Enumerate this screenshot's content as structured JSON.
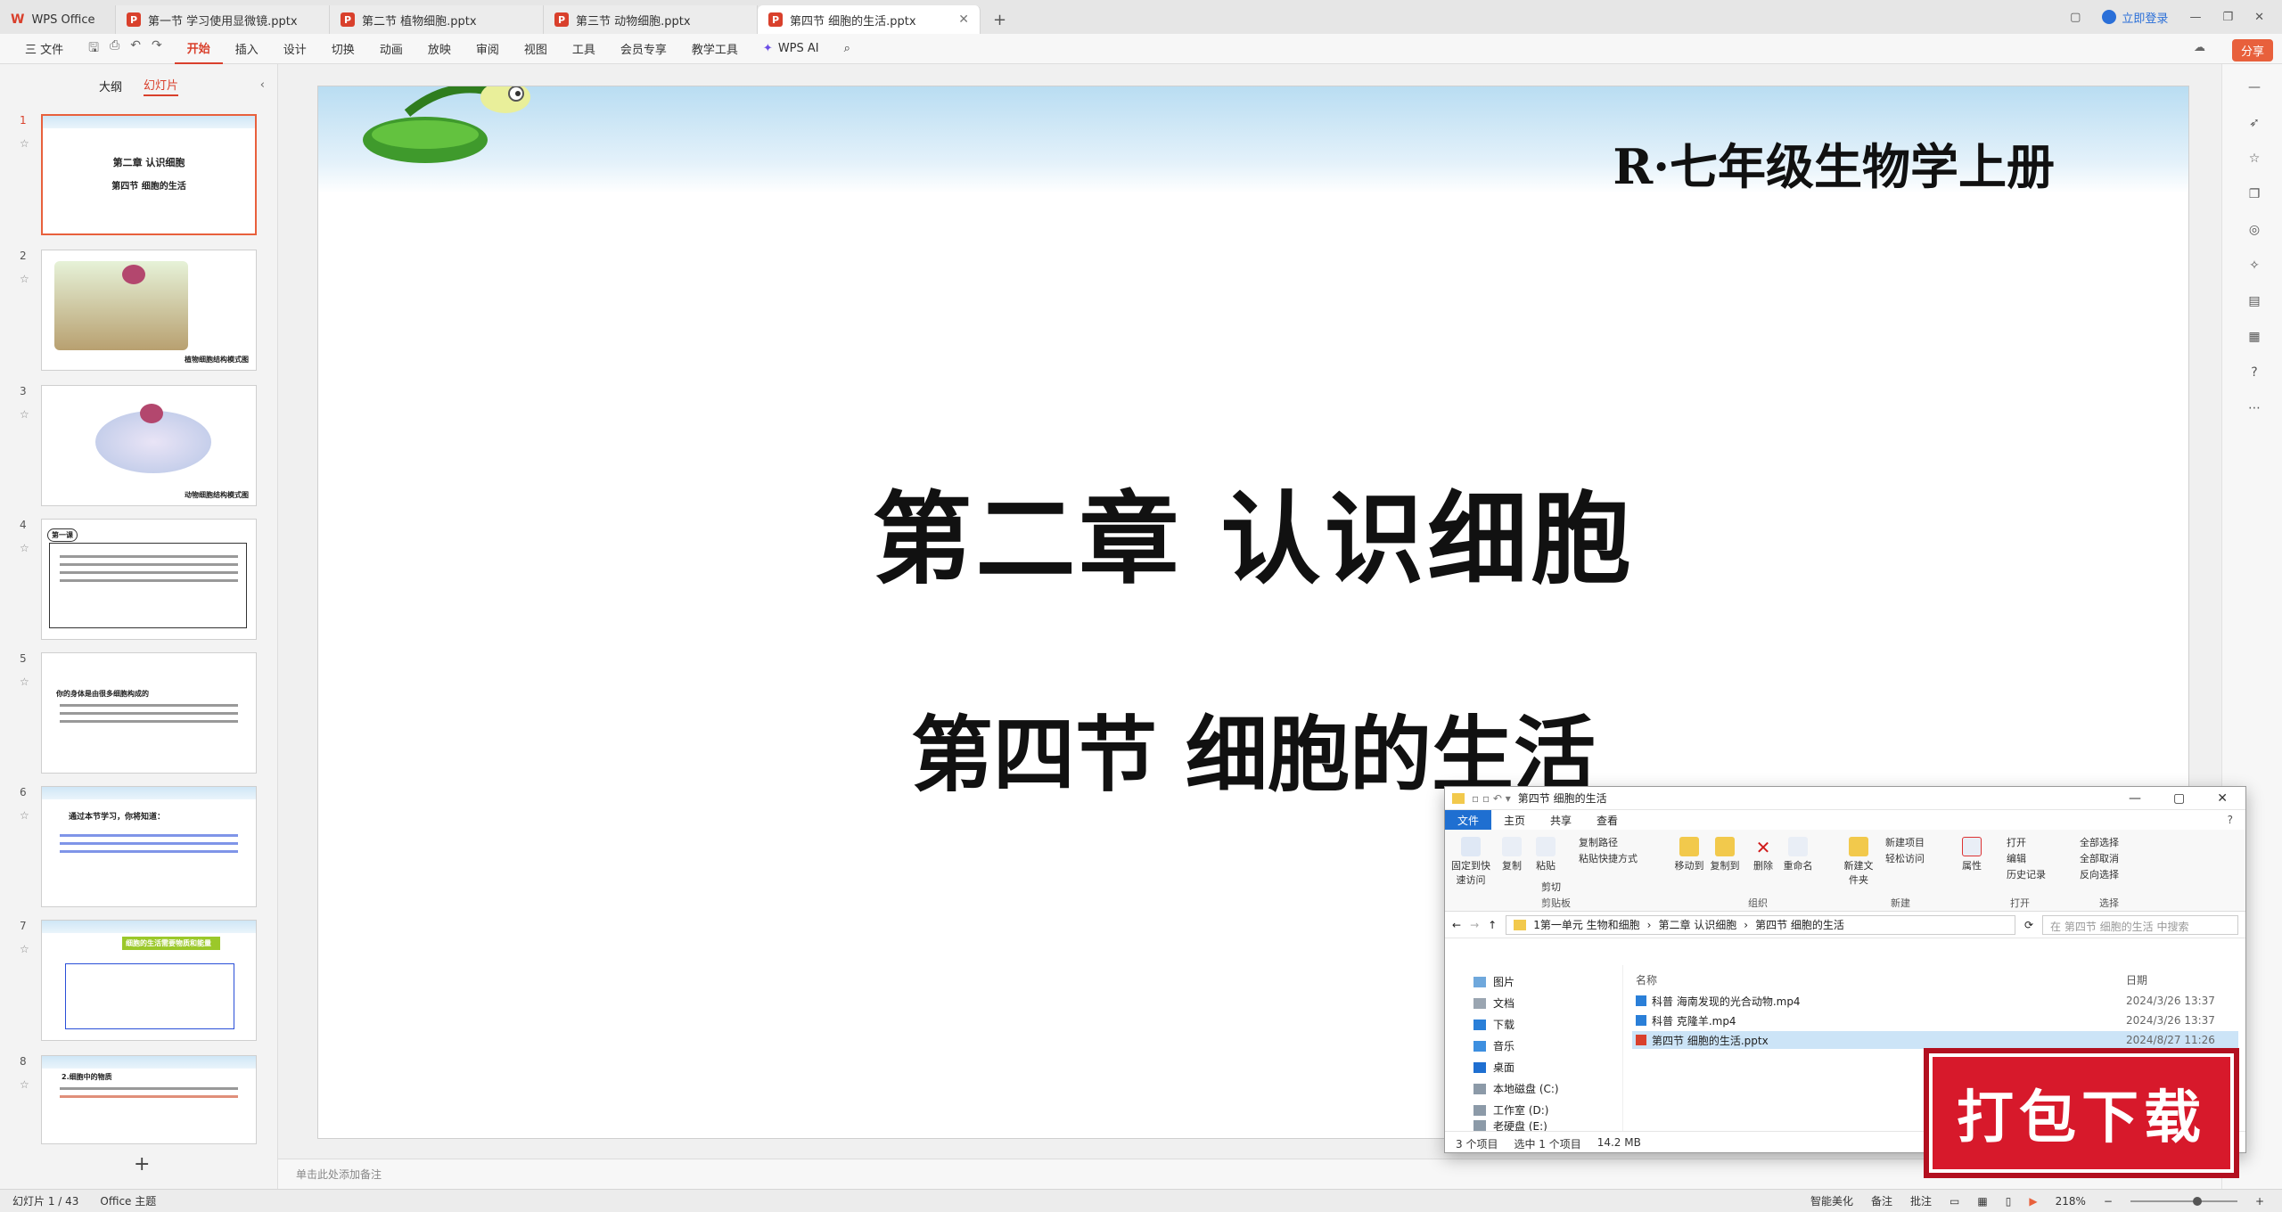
{
  "titlebar": {
    "app_tab": "WPS Office",
    "doc_tabs": [
      {
        "label": "第一节 学习使用显微镜.pptx"
      },
      {
        "label": "第二节 植物细胞.pptx"
      },
      {
        "label": "第三节 动物细胞.pptx"
      },
      {
        "label": "第四节 细胞的生活.pptx"
      }
    ],
    "login": "立即登录"
  },
  "menubar": {
    "file": "三 文件",
    "items": [
      "开始",
      "插入",
      "设计",
      "切换",
      "动画",
      "放映",
      "审阅",
      "视图",
      "工具",
      "会员专享",
      "教学工具"
    ],
    "wps_ai": "WPS AI",
    "share": "分享"
  },
  "leftpanel": {
    "tabs": [
      "大纲",
      "幻灯片"
    ],
    "slides": [
      {
        "num": "1",
        "text": "第二章 认识细胞"
      },
      {
        "num": "2",
        "text": "植物细胞结构模式图"
      },
      {
        "num": "3",
        "text": "动物细胞结构模式图"
      },
      {
        "num": "4",
        "text": "第一课"
      },
      {
        "num": "5",
        "text": "你的身体是由很多细胞构成的"
      },
      {
        "num": "6",
        "text": "通过本节学习，你将知道："
      },
      {
        "num": "7",
        "text": "细胞的生活需要物质和能量"
      },
      {
        "num": "8",
        "text": "2.细胞中的物质"
      }
    ]
  },
  "slide": {
    "subject": "R·七年级生物学上册",
    "chapter": "第二章  认识细胞",
    "section": "第四节 细胞的生活"
  },
  "notes": {
    "placeholder": "单击此处添加备注"
  },
  "statusbar": {
    "slide_count": "幻灯片 1 / 43",
    "theme": "Office 主题",
    "beautify": "智能美化",
    "notes": "备注",
    "comments": "批注",
    "zoom": "218%"
  },
  "explorer": {
    "title": "第四节 细胞的生活",
    "tabs": [
      "文件",
      "主页",
      "共享",
      "查看"
    ],
    "ribbon": {
      "pin": "固定到快速访问",
      "copy": "复制",
      "paste": "粘贴",
      "copy_path": "复制路径",
      "paste_shortcut": "粘贴快捷方式",
      "cut": "剪切",
      "move_to": "移动到",
      "copy_to": "复制到",
      "delete": "删除",
      "rename": "重命名",
      "new_folder": "新建文件夹",
      "new_item": "新建项目",
      "easy_access": "轻松访问",
      "properties": "属性",
      "open": "打开",
      "edit": "编辑",
      "history": "历史记录",
      "select_all": "全部选择",
      "select_none": "全部取消",
      "invert": "反向选择",
      "groups": [
        "剪贴板",
        "组织",
        "新建",
        "打开",
        "选择"
      ]
    },
    "breadcrumb": [
      "1第一单元 生物和细胞",
      "第二章 认识细胞",
      "第四节 细胞的生活"
    ],
    "search_placeholder": "在 第四节 细胞的生活 中搜索",
    "tree": [
      "图片",
      "文档",
      "下载",
      "音乐",
      "桌面",
      "本地磁盘 (C:)",
      "工作室 (D:)",
      "老硬盘 (E:)"
    ],
    "columns": {
      "name": "名称",
      "date": "日期"
    },
    "files": [
      {
        "name": "科普 海南发现的光合动物.mp4",
        "date": "2024/3/26 13:37"
      },
      {
        "name": "科普 克隆羊.mp4",
        "date": "2024/3/26 13:37"
      },
      {
        "name": "第四节 细胞的生活.pptx",
        "date": "2024/8/27 11:26"
      }
    ],
    "status": {
      "count": "3 个项目",
      "selected": "选中 1 个项目",
      "size": "14.2 MB"
    }
  },
  "stamp": {
    "text": "打包下载"
  }
}
